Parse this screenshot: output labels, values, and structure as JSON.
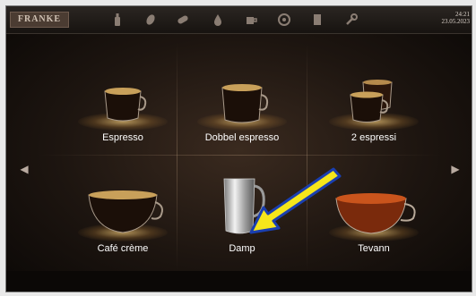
{
  "header": {
    "logo": "FRANKE",
    "time": "24:21",
    "date": "23.05.2023",
    "icons": [
      "bottle-icon",
      "bean-icon",
      "cleaning-tablet-icon",
      "drop-icon",
      "cup-icon",
      "coffee-bag-icon",
      "card-icon",
      "wrench-icon"
    ]
  },
  "products": [
    {
      "label": "Espresso"
    },
    {
      "label": "Dobbel espresso"
    },
    {
      "label": "2 espressi"
    },
    {
      "label": "Café crème"
    },
    {
      "label": "Damp"
    },
    {
      "label": "Tevann"
    }
  ],
  "annotation": {
    "color": "#f5e61b",
    "border": "#1a3fb0"
  }
}
